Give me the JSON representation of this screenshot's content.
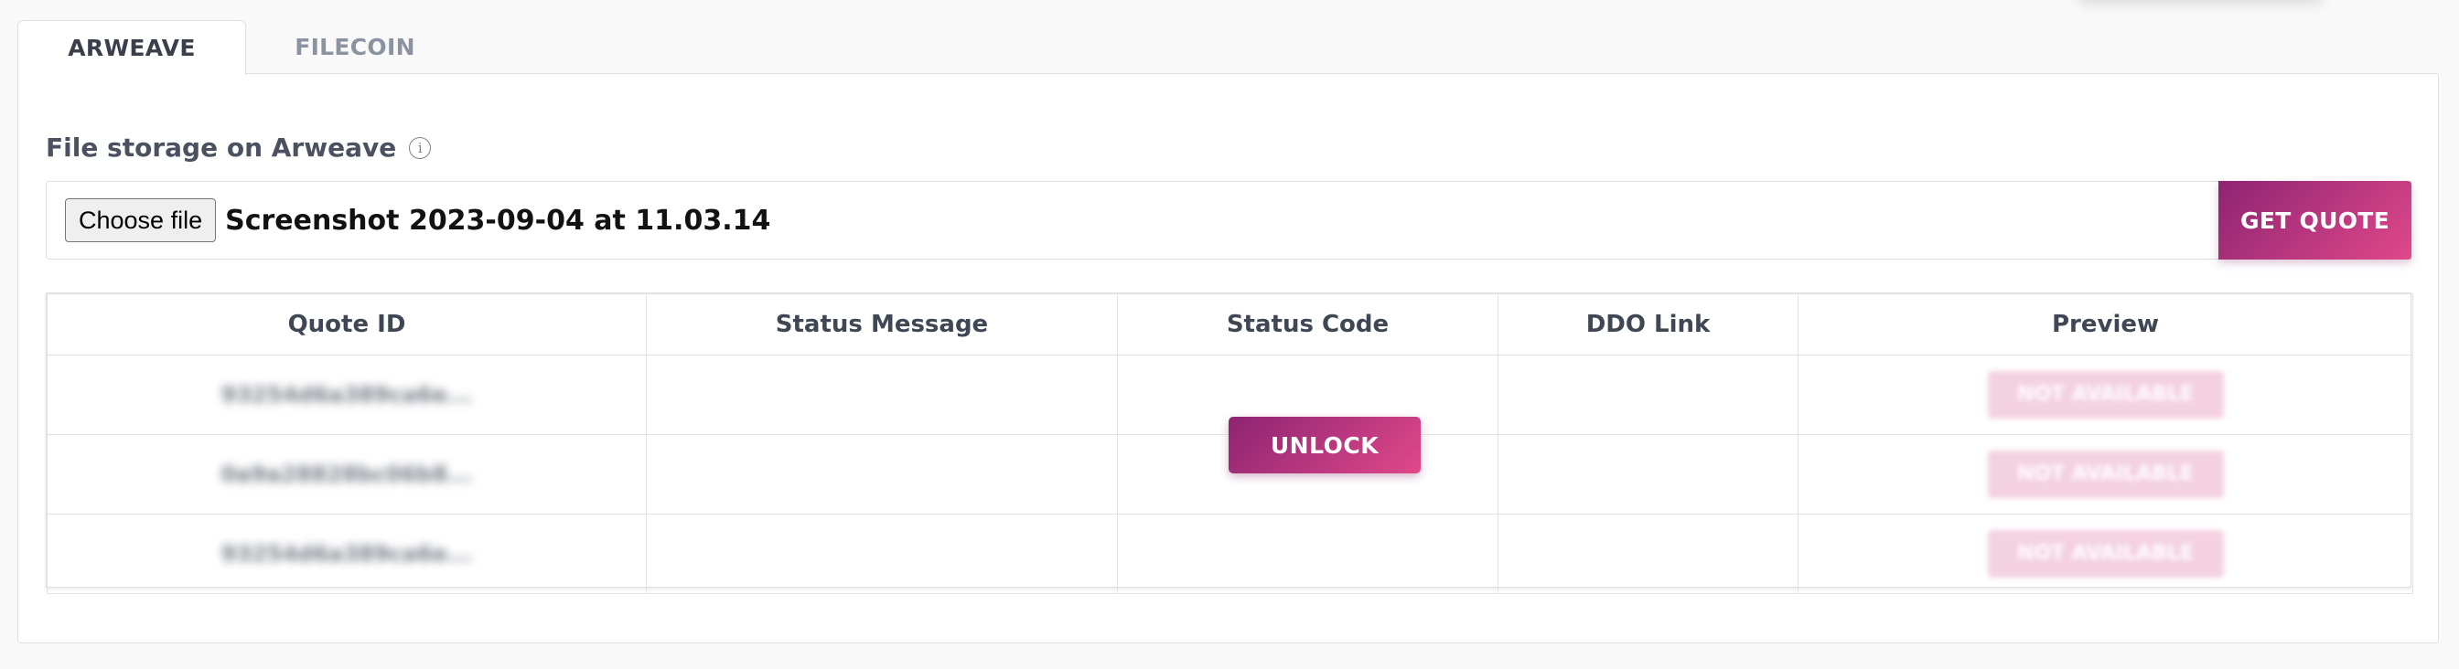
{
  "tabs": [
    {
      "label": "ARWEAVE",
      "active": true
    },
    {
      "label": "FILECOIN",
      "active": false
    }
  ],
  "storage": {
    "label": "File storage on Arweave",
    "choose_file_label": "Choose file",
    "file_name": "Screenshot 2023-09-04 at 11.03.14",
    "get_quote_label": "GET QUOTE"
  },
  "table": {
    "headers": [
      "Quote ID",
      "Status Message",
      "Status Code",
      "DDO Link",
      "Preview"
    ],
    "rows": [
      {
        "quote_id": "93254d6a389ca6e...",
        "status_message": "",
        "status_code": "",
        "ddo_link": "",
        "preview": "NOT AVAILABLE"
      },
      {
        "quote_id": "0a9a28828bc06b8...",
        "status_message": "",
        "status_code": "",
        "ddo_link": "",
        "preview": "NOT AVAILABLE"
      },
      {
        "quote_id": "93254d6a389ca6e...",
        "status_message": "",
        "status_code": "",
        "ddo_link": "",
        "preview": "NOT AVAILABLE"
      }
    ]
  },
  "unlock_label": "UNLOCK",
  "colors": {
    "accent_start": "#8d2472",
    "accent_end": "#e0488a"
  }
}
